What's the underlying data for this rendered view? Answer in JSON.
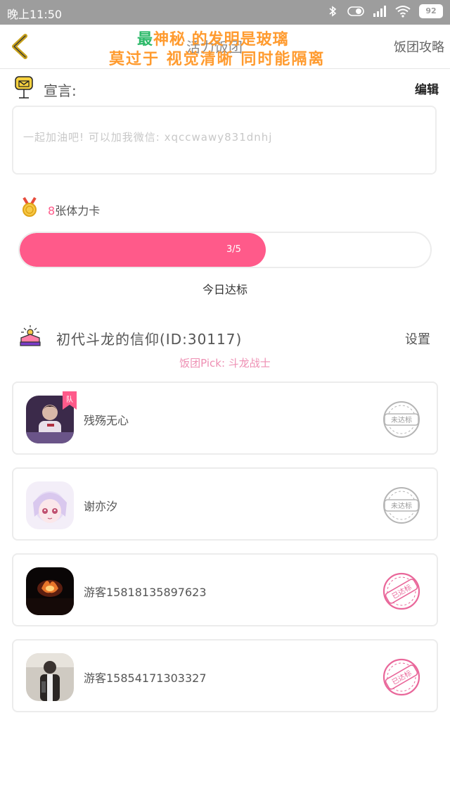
{
  "status_bar": {
    "time": "晚上11:50",
    "battery": "92"
  },
  "header": {
    "title": "活力饭团",
    "guide_label": "饭团攻略",
    "overlay_line1_lead": "最",
    "overlay_line1_rest": "神秘 的发明是玻璃",
    "overlay_line2": "莫过于 视觉清晰 同时能隔离"
  },
  "declaration": {
    "label": "宣言:",
    "edit_label": "编辑",
    "text": "一起加油吧! 可以加我微信: xqccwawy831dnhj"
  },
  "cards": {
    "count": "8",
    "label": "张体力卡"
  },
  "progress": {
    "label": "3/5",
    "fraction": 0.6
  },
  "status_today": "今日达标",
  "group": {
    "name": "初代斗龙的信仰(ID:30117)",
    "settings_label": "设置",
    "pick": "饭团Pick: 斗龙战士"
  },
  "members": [
    {
      "name": "残殇无心",
      "status": "未达标",
      "achieved": false,
      "leader": true,
      "badge": "队"
    },
    {
      "name": "谢亦汐",
      "status": "未达标",
      "achieved": false,
      "leader": false
    },
    {
      "name": "游客15818135897623",
      "status": "已达标",
      "achieved": true,
      "leader": false
    },
    {
      "name": "游客15854171303327",
      "status": "已达标",
      "achieved": true,
      "leader": false
    }
  ],
  "colors": {
    "accent": "#ff5a8a",
    "pick": "#ee8fb3",
    "stamp_gray": "#b5b5b5",
    "stamp_pink": "#e9679a"
  }
}
